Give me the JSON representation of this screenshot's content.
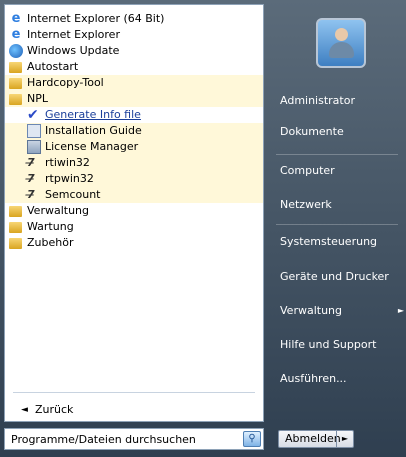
{
  "programs": [
    {
      "label": "Internet Explorer (64 Bit)",
      "icon": "internet-explorer-icon",
      "level": 0,
      "state": ""
    },
    {
      "label": "Internet Explorer",
      "icon": "internet-explorer-icon",
      "level": 0,
      "state": ""
    },
    {
      "label": "Windows Update",
      "icon": "windows-update-icon",
      "level": 0,
      "state": ""
    },
    {
      "label": "Autostart",
      "icon": "folder-icon",
      "level": 0,
      "state": ""
    },
    {
      "label": "Hardcopy-Tool",
      "icon": "folder-icon",
      "level": 0,
      "state": "hl"
    },
    {
      "label": "NPL",
      "icon": "folder-icon",
      "level": 0,
      "state": "hl"
    },
    {
      "label": "Generate Info file",
      "icon": "checkmark-icon",
      "level": 1,
      "state": "link"
    },
    {
      "label": "Installation Guide",
      "icon": "document-icon",
      "level": 1,
      "state": "hl"
    },
    {
      "label": "License Manager",
      "icon": "license-icon",
      "level": 1,
      "state": "hl"
    },
    {
      "label": "rtiwin32",
      "icon": "tool-icon",
      "level": 1,
      "state": "hl"
    },
    {
      "label": "rtpwin32",
      "icon": "tool-icon",
      "level": 1,
      "state": "hl"
    },
    {
      "label": "Semcount",
      "icon": "tool-icon",
      "level": 1,
      "state": "hl"
    },
    {
      "label": "Verwaltung",
      "icon": "folder-icon",
      "level": 0,
      "state": ""
    },
    {
      "label": "Wartung",
      "icon": "folder-icon",
      "level": 0,
      "state": ""
    },
    {
      "label": "Zubehör",
      "icon": "folder-icon",
      "level": 0,
      "state": ""
    }
  ],
  "back_label": "Zurück",
  "search_label": "Programme/Dateien durchsuchen",
  "right": {
    "administrator": "Administrator",
    "dokumente": "Dokumente",
    "computer": "Computer",
    "netzwerk": "Netzwerk",
    "systemsteuerung": "Systemsteuerung",
    "geraete": "Geräte und Drucker",
    "verwaltung": "Verwaltung",
    "hilfe": "Hilfe und Support",
    "ausfuehren": "Ausführen..."
  },
  "logoff_label": "Abmelden"
}
